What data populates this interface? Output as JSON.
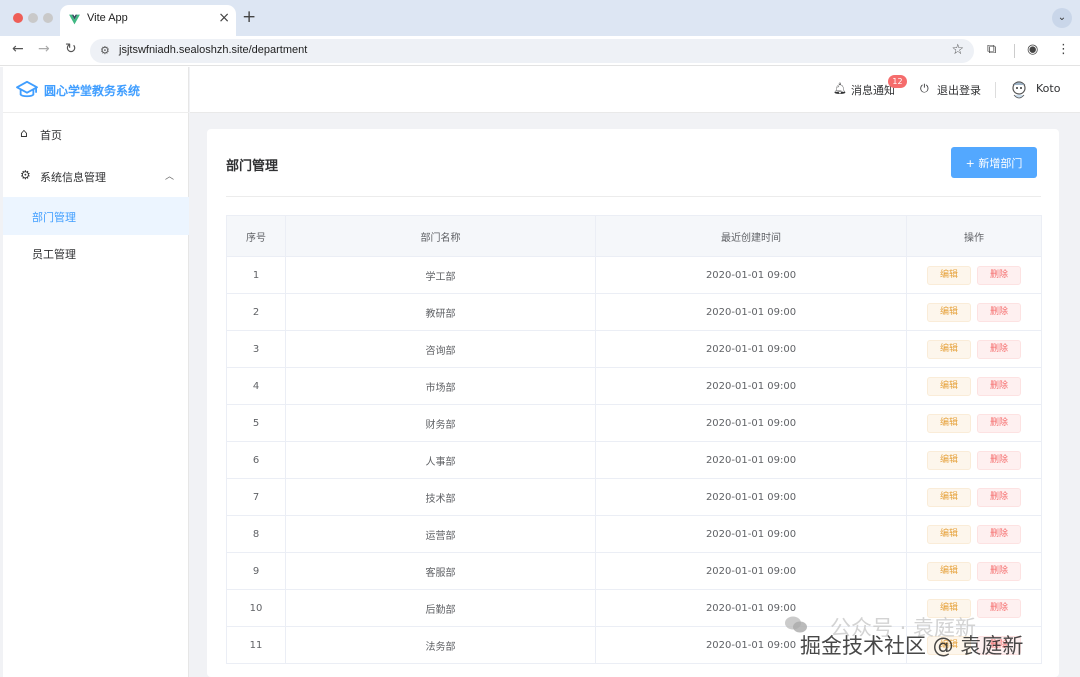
{
  "browser": {
    "tab_title": "Vite App",
    "url": "jsjtswfniadh.sealoshzh.site/department",
    "tab_close_icon": "close-icon",
    "new_tab_label": "+"
  },
  "app": {
    "logo_text": "圆心学堂教务系统",
    "sidebar": {
      "home_label": "首页",
      "system_menu_label": "系统信息管理",
      "sub_items": [
        {
          "label": "部门管理",
          "active": true
        },
        {
          "label": "员工管理",
          "active": false
        }
      ]
    },
    "header": {
      "notifications_label": "消息通知",
      "notifications_count": "12",
      "logout_label": "退出登录",
      "username": "Koto"
    },
    "page": {
      "title": "部门管理",
      "add_button_label": "+ 新增部门"
    },
    "table": {
      "columns": [
        "序号",
        "部门名称",
        "最近创建时间",
        "操作"
      ],
      "edit_label": "编辑",
      "delete_label": "删除",
      "rows": [
        {
          "index": "1",
          "name": "学工部",
          "time": "2020-01-01 09:00"
        },
        {
          "index": "2",
          "name": "教研部",
          "time": "2020-01-01 09:00"
        },
        {
          "index": "3",
          "name": "咨询部",
          "time": "2020-01-01 09:00"
        },
        {
          "index": "4",
          "name": "市场部",
          "time": "2020-01-01 09:00"
        },
        {
          "index": "5",
          "name": "财务部",
          "time": "2020-01-01 09:00"
        },
        {
          "index": "6",
          "name": "人事部",
          "time": "2020-01-01 09:00"
        },
        {
          "index": "7",
          "name": "技术部",
          "time": "2020-01-01 09:00"
        },
        {
          "index": "8",
          "name": "运营部",
          "time": "2020-01-01 09:00"
        },
        {
          "index": "9",
          "name": "客服部",
          "time": "2020-01-01 09:00"
        },
        {
          "index": "10",
          "name": "后勤部",
          "time": "2020-01-01 09:00"
        },
        {
          "index": "11",
          "name": "法务部",
          "time": "2020-01-01 09:00"
        }
      ]
    },
    "colors": {
      "primary": "#409eff",
      "warning": "#e6a23c",
      "danger": "#f56c6c"
    }
  },
  "watermark": {
    "line1": "公众号 · 袁庭新",
    "line2": "掘金技术社区 @ 袁庭新"
  }
}
